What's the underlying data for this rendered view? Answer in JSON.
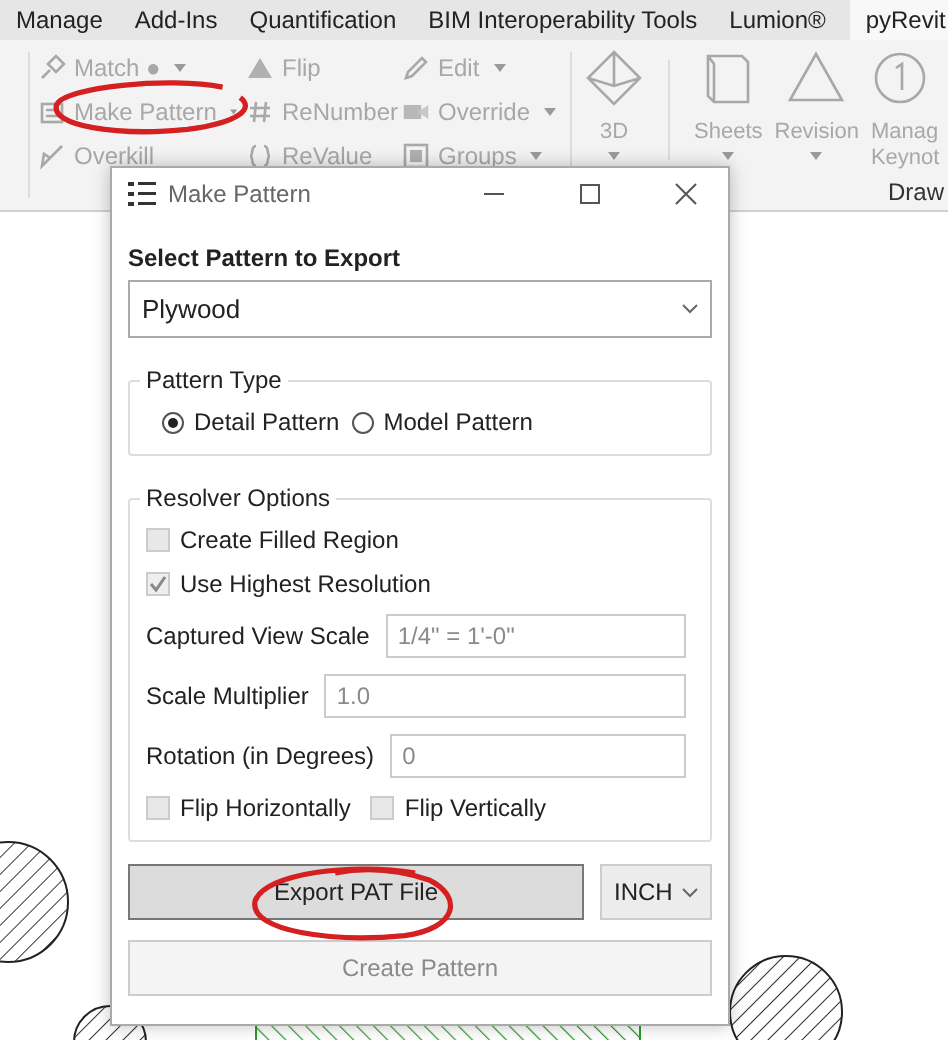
{
  "ribbon_tabs": [
    {
      "label": "Manage",
      "selected": false
    },
    {
      "label": "Add-Ins",
      "selected": false
    },
    {
      "label": "Quantification",
      "selected": false
    },
    {
      "label": "BIM Interoperability Tools",
      "selected": false
    },
    {
      "label": "Lumion®",
      "selected": false
    },
    {
      "label": "pyRevit",
      "selected": true
    }
  ],
  "ribbon": {
    "columns": [
      {
        "items": [
          {
            "kind": "match",
            "label": "Match ●",
            "dropdown": true
          },
          {
            "kind": "pattern",
            "label": "Make Pattern",
            "dropdown": true
          },
          {
            "kind": "broom",
            "label": "Overkill",
            "dropdown": false
          }
        ]
      },
      {
        "items": [
          {
            "kind": "warning",
            "label": "Flip",
            "dropdown": false
          },
          {
            "kind": "hash",
            "label": "ReNumber",
            "dropdown": false
          },
          {
            "kind": "braces",
            "label": "ReValue",
            "dropdown": false
          }
        ]
      },
      {
        "items": [
          {
            "kind": "pencil",
            "label": "Edit",
            "dropdown": true
          },
          {
            "kind": "override",
            "label": "Override",
            "dropdown": true
          },
          {
            "kind": "groups",
            "label": "Groups",
            "dropdown": true
          }
        ]
      }
    ],
    "large_buttons": [
      {
        "kind": "cube",
        "lines": [
          "3D"
        ],
        "dropdown": true
      },
      {
        "kind": "book",
        "lines": [
          "Sheets"
        ],
        "dropdown": true
      },
      {
        "kind": "triangle",
        "lines": [
          "Revision"
        ],
        "dropdown": true
      },
      {
        "kind": "keynote",
        "lines": [
          "Manag",
          "Keynot"
        ],
        "dropdown": false
      }
    ],
    "panel_label": "Draw"
  },
  "dialog": {
    "title": "Make Pattern",
    "select_label": "Select Pattern to Export",
    "pattern_select": {
      "value": "Plywood"
    },
    "pattern_type": {
      "legend": "Pattern Type",
      "options": [
        {
          "label": "Detail Pattern",
          "selected": true
        },
        {
          "label": "Model Pattern",
          "selected": false
        }
      ]
    },
    "resolver_options": {
      "legend": "Resolver Options",
      "checkboxes": [
        {
          "label": "Create Filled Region",
          "checked": false
        },
        {
          "label": "Use Highest Resolution",
          "checked": true
        }
      ],
      "fields": [
        {
          "label": "Captured View Scale",
          "value": "1/4\" = 1'-0\"",
          "disabled": true
        },
        {
          "label": "Scale Multiplier",
          "value": "1.0",
          "disabled": true
        },
        {
          "label": "Rotation (in Degrees)",
          "value": "0",
          "disabled": true
        }
      ],
      "flip_options": [
        {
          "label": "Flip Horizontally",
          "checked": false
        },
        {
          "label": "Flip Vertically",
          "checked": false
        }
      ]
    },
    "export_button": {
      "label": "Export PAT File"
    },
    "unit_select": {
      "value": "INCH"
    },
    "create_button": {
      "label": "Create Pattern",
      "disabled": true
    }
  }
}
